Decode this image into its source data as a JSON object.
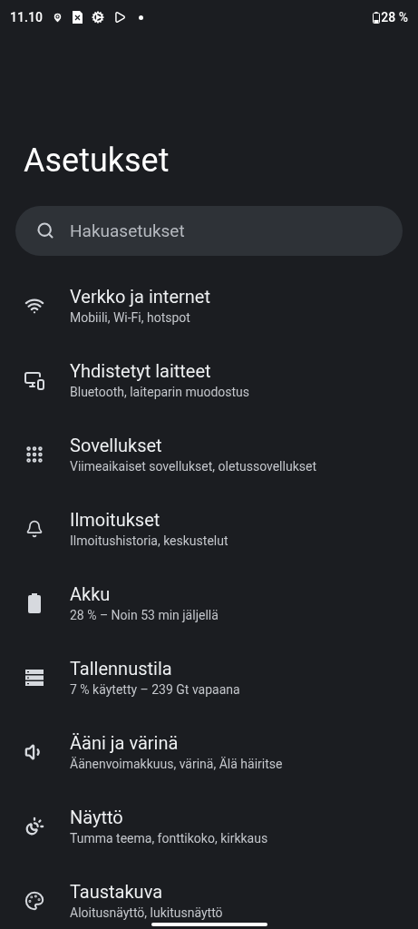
{
  "status_bar": {
    "time": "11.10",
    "battery": "28 %"
  },
  "title": "Asetukset",
  "search": {
    "placeholder": "Hakuasetukset"
  },
  "items": [
    {
      "kind": "wifi",
      "title": "Verkko ja internet",
      "subtitle": "Mobiili, Wi-Fi, hotspot"
    },
    {
      "kind": "devices",
      "title": "Yhdistetyt laitteet",
      "subtitle": "Bluetooth, laiteparin muodostus"
    },
    {
      "kind": "apps",
      "title": "Sovellukset",
      "subtitle": "Viimeaikaiset sovellukset, oletussovellukset"
    },
    {
      "kind": "bell",
      "title": "Ilmoitukset",
      "subtitle": "Ilmoitushistoria, keskustelut"
    },
    {
      "kind": "battery",
      "title": "Akku",
      "subtitle": "28 % – Noin 53 min jäljellä"
    },
    {
      "kind": "storage",
      "title": "Tallennustila",
      "subtitle": "7 % käytetty – 239 Gt vapaana"
    },
    {
      "kind": "sound",
      "title": "Ääni ja värinä",
      "subtitle": "Äänenvoimakkuus, värinä, Älä häiritse"
    },
    {
      "kind": "display",
      "title": "Näyttö",
      "subtitle": "Tumma teema, fonttikoko, kirkkaus"
    },
    {
      "kind": "palette",
      "title": "Taustakuva",
      "subtitle": "Aloitusnäyttö, lukitusnäyttö"
    }
  ]
}
